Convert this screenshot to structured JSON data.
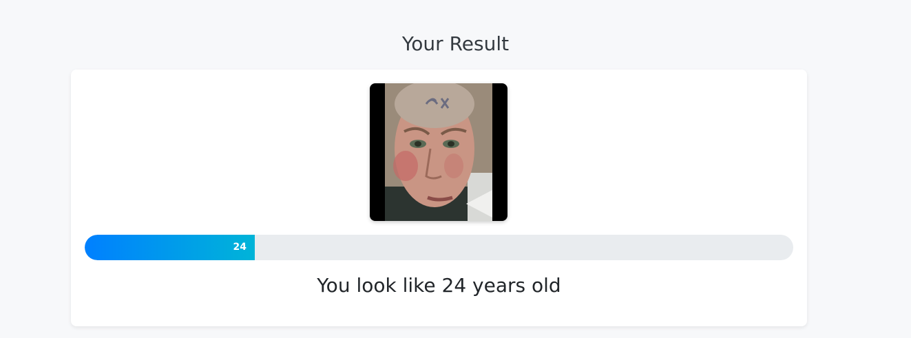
{
  "page": {
    "heading": "Your Result"
  },
  "result": {
    "photo_icon": "face-photo",
    "predicted_age": "24",
    "progress_fraction": 0.24,
    "message": "You look like 24 years old",
    "colors": {
      "bar_start": "#0080ff",
      "bar_end": "#00b4d8",
      "track": "#e9ecef"
    }
  }
}
